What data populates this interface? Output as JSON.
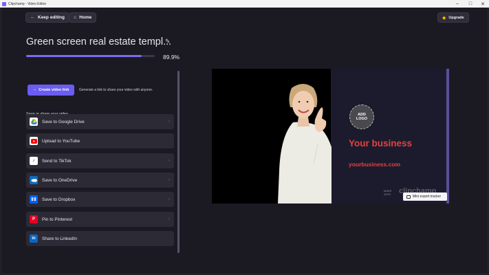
{
  "window": {
    "title": "Clipchamp - Video Editor",
    "minimize": "–",
    "maximize": "□",
    "close": "✕"
  },
  "header": {
    "keep_editing": "Keep editing",
    "home": "Home",
    "upgrade": "Upgrade"
  },
  "project": {
    "title": "Green screen real estate templ...",
    "progress_percent": 89.9,
    "progress_label": "89.9%"
  },
  "link": {
    "button": "Create video link",
    "description": "Generate a link to share your video with anyone."
  },
  "share": {
    "section_label": "Save or share your video",
    "items": [
      {
        "label": "Save to Google Drive",
        "icon": "google-drive-icon",
        "color": "#ffffff"
      },
      {
        "label": "Upload to YouTube",
        "icon": "youtube-icon",
        "color": "#ffffff"
      },
      {
        "label": "Send to TikTok",
        "icon": "tiktok-icon",
        "color": "#ffffff"
      },
      {
        "label": "Save to OneDrive",
        "icon": "onedrive-icon",
        "color": "#0f6cbd"
      },
      {
        "label": "Save to Dropbox",
        "icon": "dropbox-icon",
        "color": "#0061fe"
      },
      {
        "label": "Pin to Pinterest",
        "icon": "pinterest-icon",
        "color": "#e60023"
      },
      {
        "label": "Share to LinkedIn",
        "icon": "linkedin-icon",
        "color": "#0a66c2"
      }
    ]
  },
  "preview": {
    "add_logo_line1": "ADD",
    "add_logo_line2": "LOGO",
    "business": "Your business",
    "url": "yourbusiness.com",
    "watermark_made": "MADE",
    "watermark_with": "WITH",
    "watermark_brand": "clipchamp"
  },
  "tracker": {
    "label": "Mini export tracker"
  },
  "colors": {
    "accent": "#6b5cf2",
    "brand_red": "#e0433f",
    "background": "#1b1a23"
  }
}
